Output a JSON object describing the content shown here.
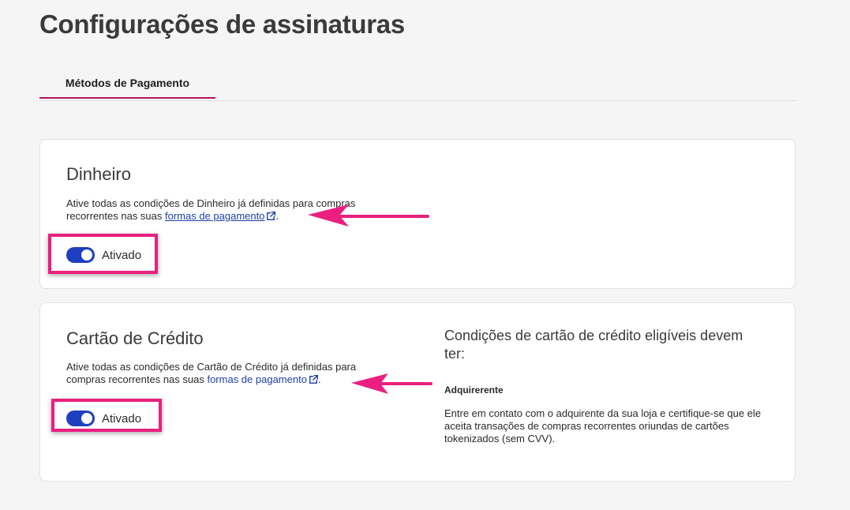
{
  "page_title": "Configurações de assinaturas",
  "tabs": [
    {
      "label": "Métodos de Pagamento"
    }
  ],
  "cash": {
    "title": "Dinheiro",
    "desc_before": "Ative todas as condições de Dinheiro já definidas para compras recorrentes nas suas ",
    "link_label": "formas de pagamento",
    "desc_after": ".",
    "toggle_label": "Ativado"
  },
  "credit": {
    "title": "Cartão de Crédito",
    "desc_before": "Ative todas as condições de Cartão de Crédito já definidas para compras recorrentes nas suas ",
    "link_label": "formas de pagamento",
    "desc_after": ".",
    "toggle_label": "Ativado",
    "side_title": "Condições de cartão de crédito eligíveis devem ter:",
    "side_subtitle": "Adquirerente",
    "side_text": "Entre em contato com o adquirente da sua loja e certifique-se que ele aceita transações de compras recorrentes oriundas de cartões tokenizados (sem CVV)."
  },
  "colors": {
    "accent": "#b3125a",
    "toggle_on": "#1e3fbf",
    "annotation": "#ea1f80",
    "link": "#1f3fa8"
  },
  "icons": {
    "external_link": "external-link-icon"
  }
}
